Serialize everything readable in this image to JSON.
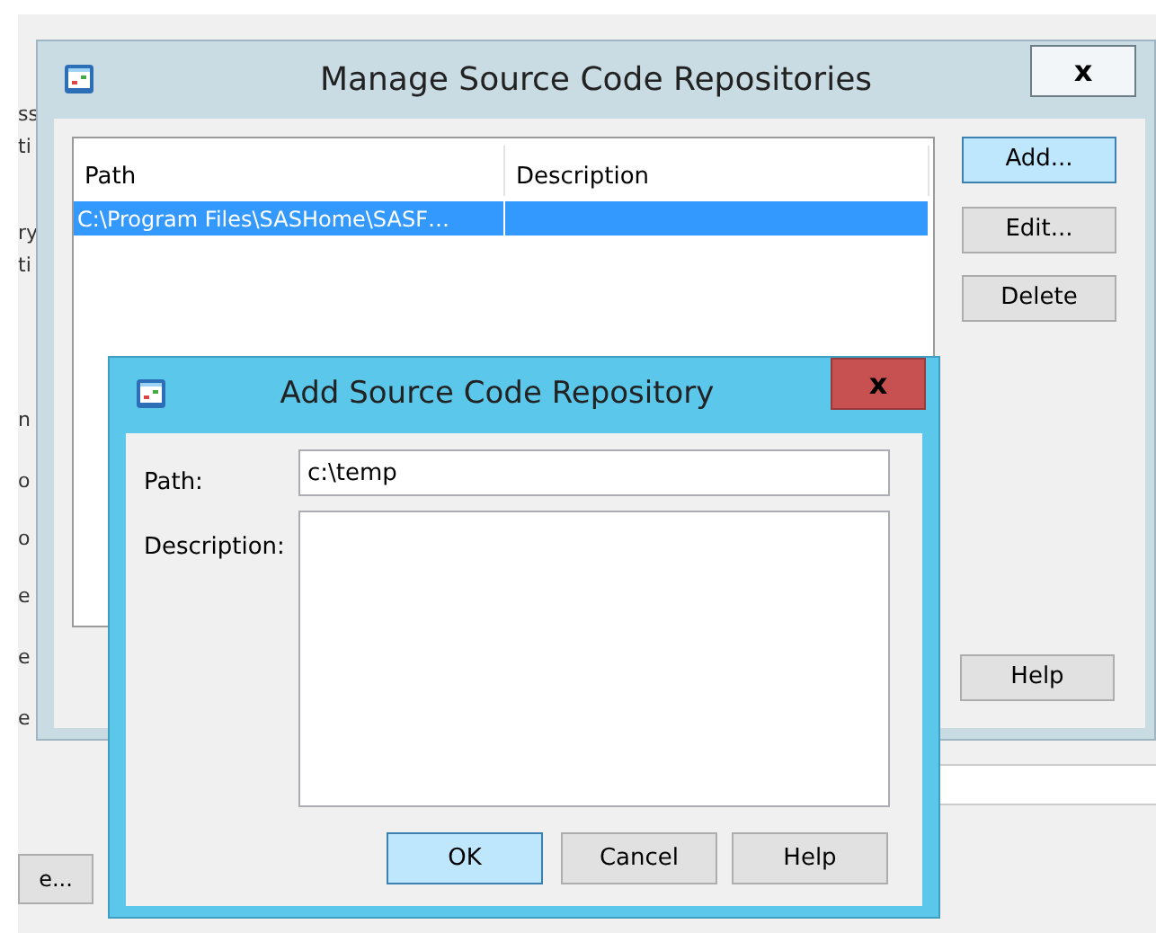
{
  "background": {
    "fragments": [
      "ss",
      "ti",
      "ry",
      "ti",
      "n",
      "o",
      "o",
      "e",
      "e",
      "e"
    ],
    "button": "e..."
  },
  "manage_window": {
    "title": "Manage Source Code Repositories",
    "close": "x",
    "table": {
      "columns": [
        "Path",
        "Description"
      ],
      "rows": [
        {
          "path": "C:\\Program Files\\SASHome\\SASF…",
          "selected": true
        }
      ]
    },
    "buttons": [
      {
        "label": "Add...",
        "selected": true
      },
      {
        "label": "Edit...",
        "selected": false
      },
      {
        "label": "Delete",
        "selected": false
      },
      {
        "label": "Help",
        "selected": false
      }
    ]
  },
  "add_dialog": {
    "title": "Add Source Code Repository",
    "close": "x",
    "fields": [
      {
        "label": "Path:",
        "value": "c:\\temp",
        "kind": "line"
      },
      {
        "label": "Description:",
        "kind": "area"
      }
    ],
    "buttons": [
      {
        "label": "OK",
        "selected": true
      },
      {
        "label": "Cancel",
        "selected": false
      },
      {
        "label": "Help",
        "selected": false
      }
    ]
  }
}
